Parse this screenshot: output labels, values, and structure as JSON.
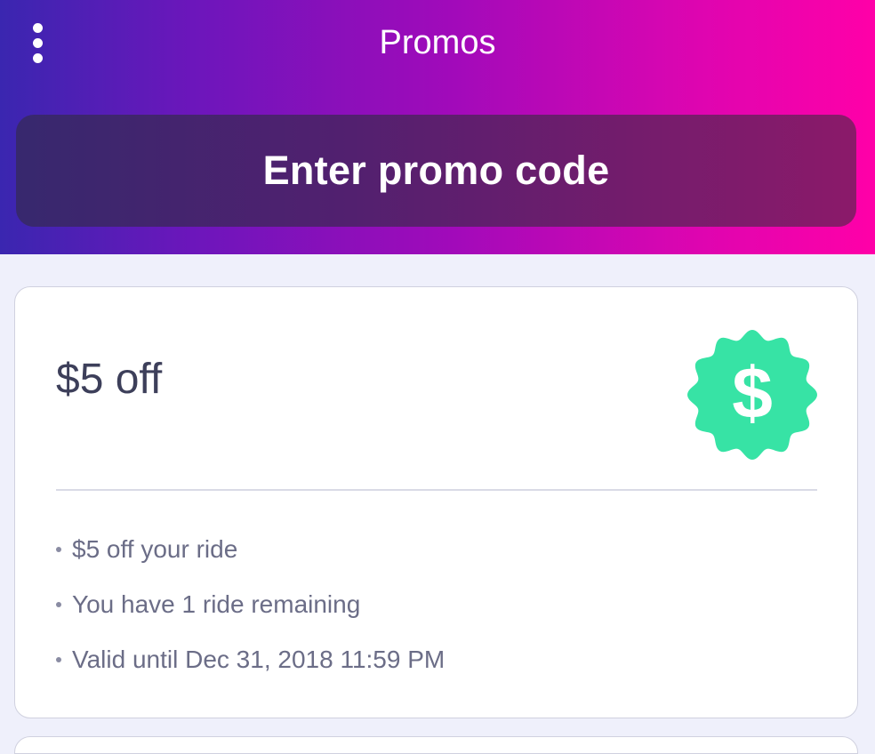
{
  "header": {
    "title": "Promos",
    "menu_icon": "more-vertical-icon",
    "gradient": [
      "#3a26b0",
      "#a20aba",
      "#ff00a8"
    ]
  },
  "promo_button": {
    "label": "Enter promo code"
  },
  "promos": [
    {
      "amount": "$5 off",
      "badge_icon": "dollar-badge-icon",
      "badge_color": "#37e3a5",
      "details": [
        "$5 off your ride",
        "You have 1 ride remaining",
        "Valid until Dec 31, 2018 11:59 PM"
      ]
    }
  ]
}
